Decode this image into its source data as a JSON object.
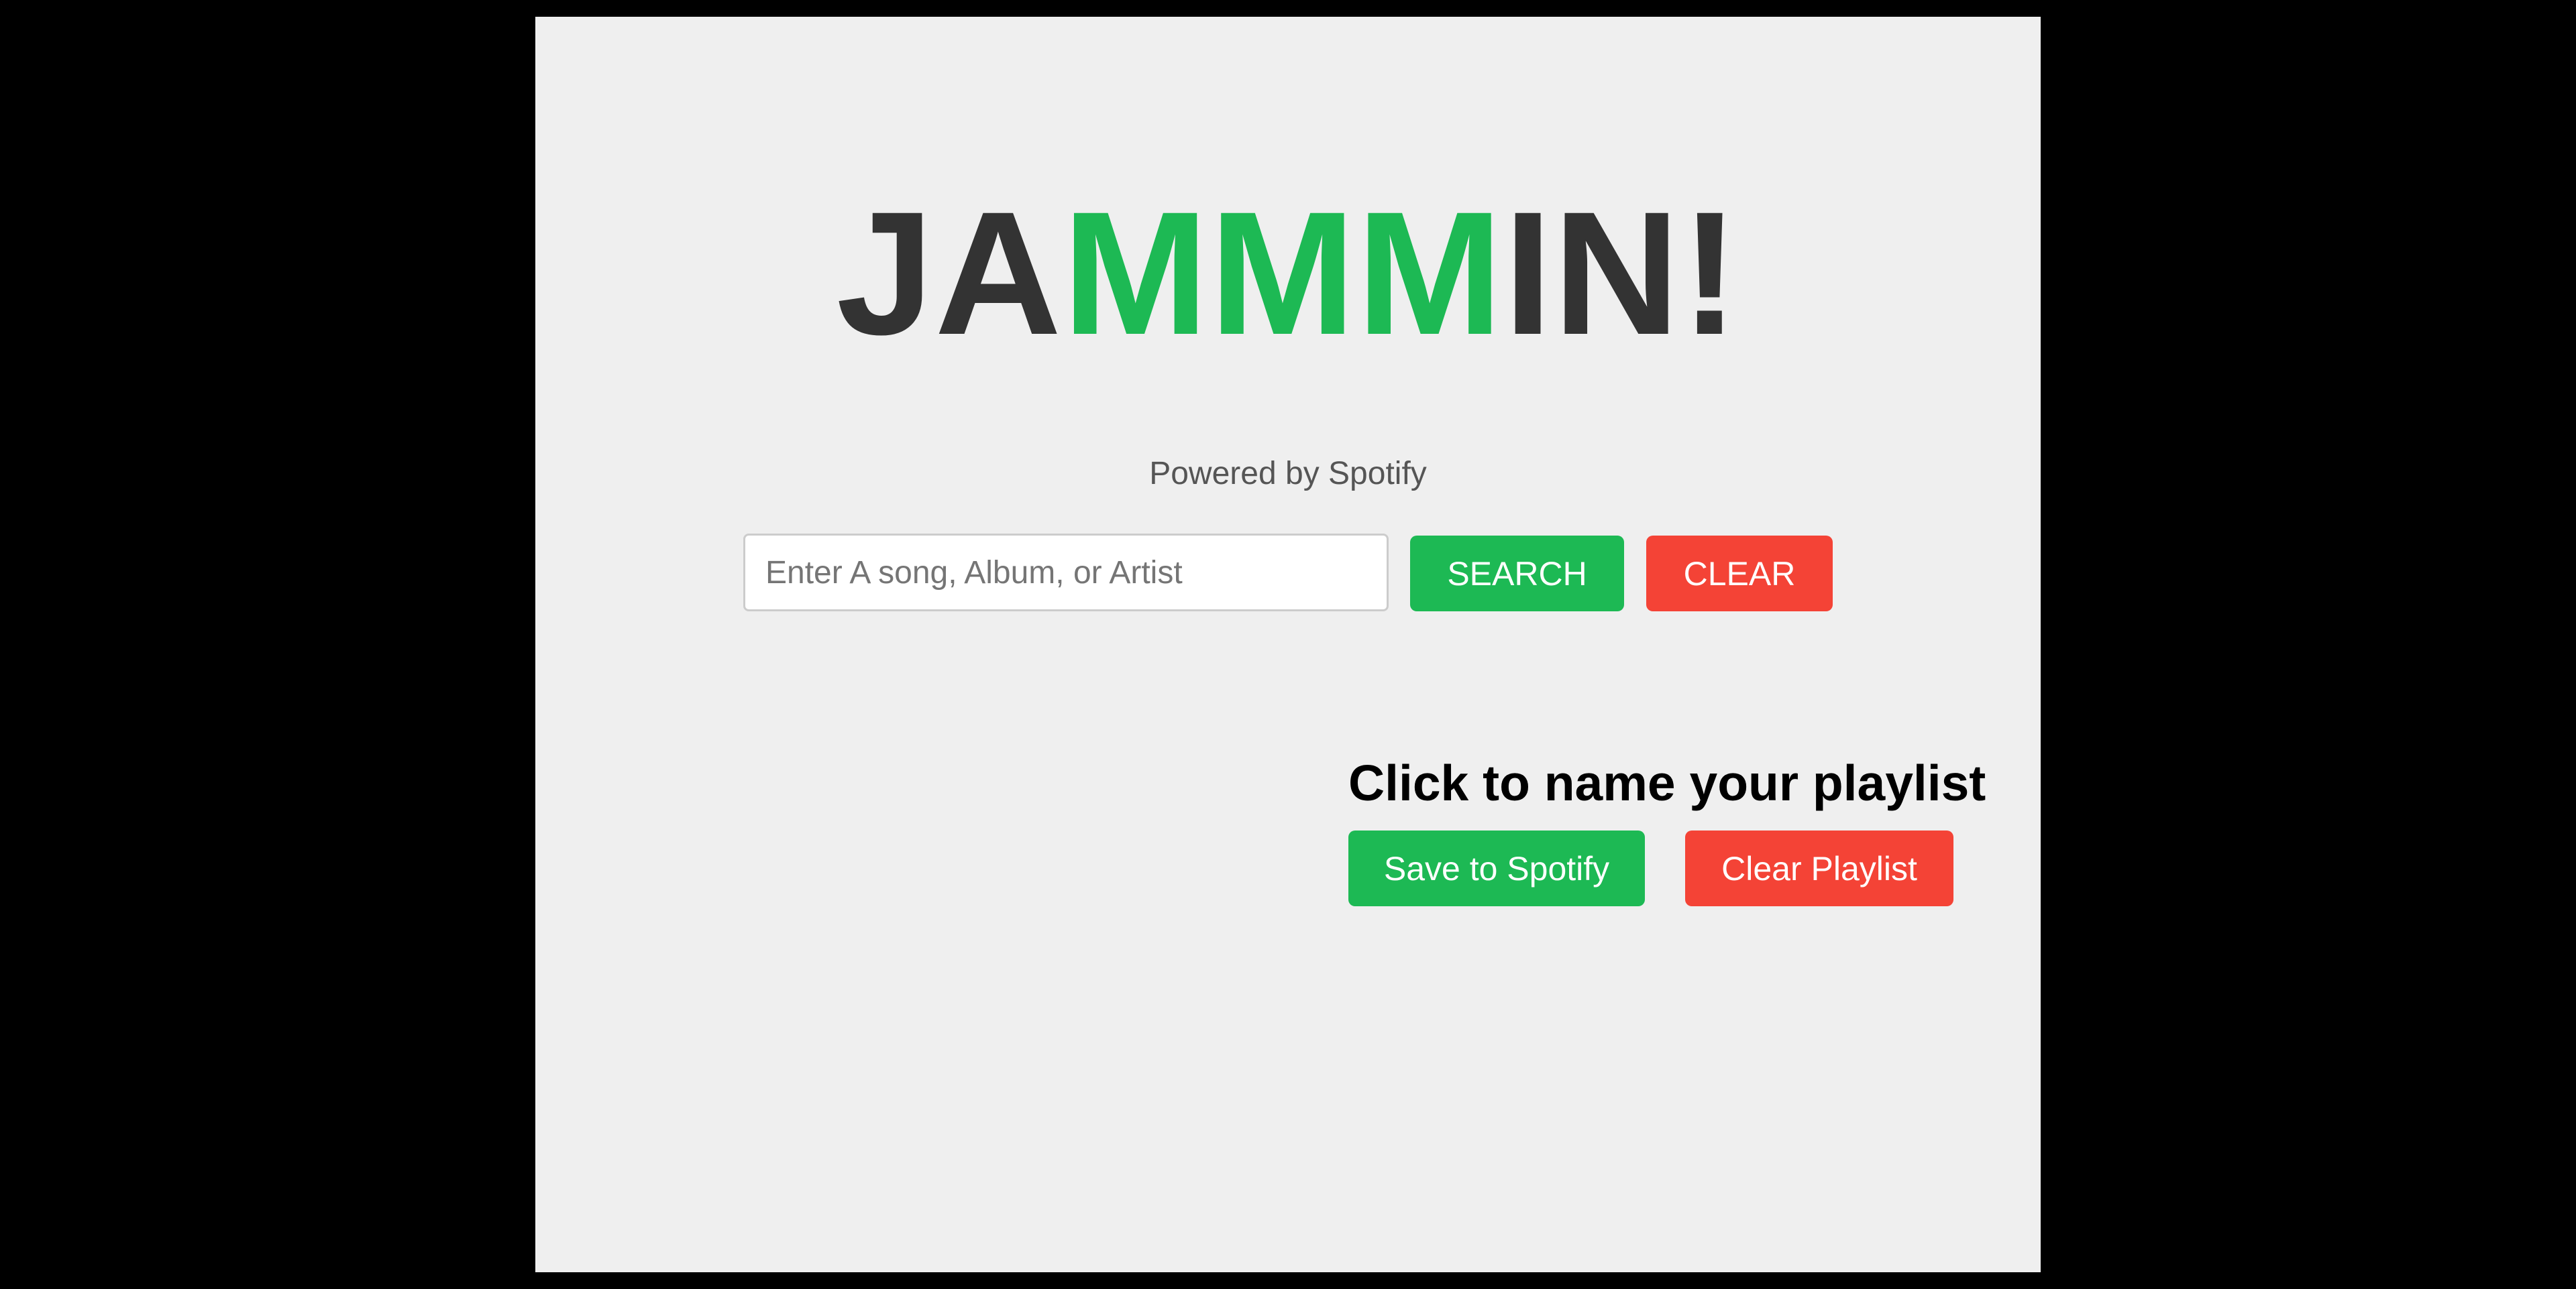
{
  "header": {
    "logo_parts": [
      "JA",
      "MMM",
      "IN!"
    ]
  },
  "colors": {
    "background": "#000000",
    "panel": "#efefef",
    "logo_dark": "#333333",
    "accent_green": "#1db954",
    "danger_red": "#f44336"
  },
  "search": {
    "powered_by": "Powered by Spotify",
    "placeholder": "Enter A song, Album, or Artist",
    "value": "",
    "search_label": "SEARCH",
    "clear_label": "CLEAR"
  },
  "playlist": {
    "title": "Click to name your playlist",
    "save_label": "Save to Spotify",
    "clear_label": "Clear Playlist"
  }
}
